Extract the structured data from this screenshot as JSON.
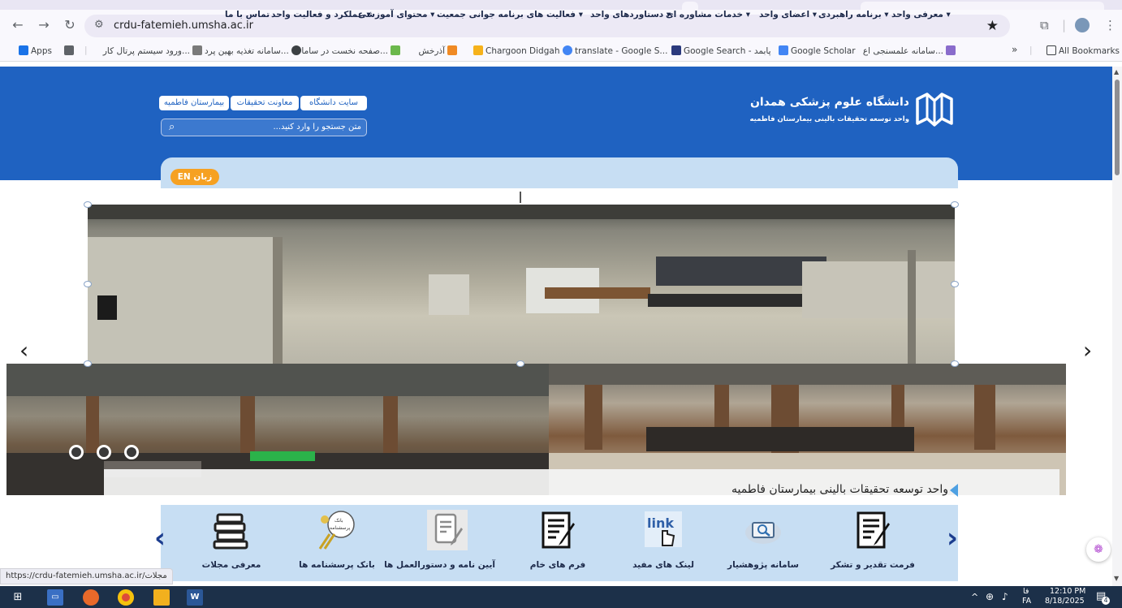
{
  "browser": {
    "url": "crdu-fatemieh.umsha.ac.ir",
    "status_url": "https://crdu-fatemieh.umsha.ac.ir/مجلات",
    "bookmarks": [
      {
        "label": "Apps",
        "color": "#1a73e8"
      },
      {
        "label": "",
        "color": "#5f6368"
      },
      {
        "label": "ورود سیستم پرتال کار...",
        "color": "#7a7a7a"
      },
      {
        "label": "سامانه تغذیه بهین پرد...",
        "color": "#3c4043"
      },
      {
        "label": "صفحه نخست در ساما...",
        "color": "#6bb84c"
      },
      {
        "label": "آذرخش",
        "color": "#f08a24"
      },
      {
        "label": "Chargoon Didgah",
        "color": "#f6b21b"
      },
      {
        "label": "translate - Google S...",
        "color": "#4285f4"
      },
      {
        "label": "Google Search - پابمد",
        "color": "#2b3a7d"
      },
      {
        "label": "Google Scholar",
        "color": "#4285f4"
      },
      {
        "label": "سامانه علمسنجی اع...",
        "color": "#8a6ccc"
      }
    ],
    "overflow": "»",
    "all_bookmarks": "All Bookmarks"
  },
  "header": {
    "title": "دانشگاه علوم پزشکی همدان",
    "subtitle": "واحد توسعه تحقیقات بالینی بیمارستان فاطمیه",
    "top_links": [
      "بیمارستان فاطمیه",
      "معاونت تحقیقات",
      "سایت دانشگاه"
    ],
    "search_placeholder": "متن جستجو را وارد کنید..."
  },
  "menu": {
    "items": [
      "▾ معرفی واحد",
      "▾ برنامه راهبردی",
      "▾ اعضای واحد",
      "▾ خدمات مشاوره ای",
      "▾ دستاوردهای واحد",
      "▾ فعالیت های برنامه جوانی جمعیت",
      "▾ محتوای آموزشی",
      "▾ عملکرد و فعالیت واحد",
      "تماس با ما"
    ],
    "language_button": "زبان EN"
  },
  "slider": {
    "caption": "واحد توسعه تحقیقات بالینی بیمارستان فاطمیه",
    "dots": 3,
    "prev_icon": "‹",
    "next_icon": "›"
  },
  "quick_links": [
    {
      "label": "فرمت تقدیر و تشکر",
      "icon": "document-pen-icon"
    },
    {
      "label": "سامانه پژوهشیار",
      "icon": "search-monitor-icon"
    },
    {
      "label": "لینک های مفید",
      "icon": "link-hand-icon"
    },
    {
      "label": "فرم های خام",
      "icon": "form-pen-icon"
    },
    {
      "label": "آیین نامه و دستورالعمل ها",
      "icon": "gray-document-icon"
    },
    {
      "label": "بانک پرسشنامه ها",
      "icon": "questionnaire-bank-icon",
      "badge_top": "بانک",
      "badge_bottom": "پرسشنامه"
    },
    {
      "label": "معرفی مجلات",
      "icon": "journal-stack-icon"
    }
  ],
  "taskbar": {
    "time": "12:10 PM",
    "date": "8/18/2025",
    "lang_top": "فا",
    "lang_bottom": "FA",
    "notifications": "4"
  }
}
